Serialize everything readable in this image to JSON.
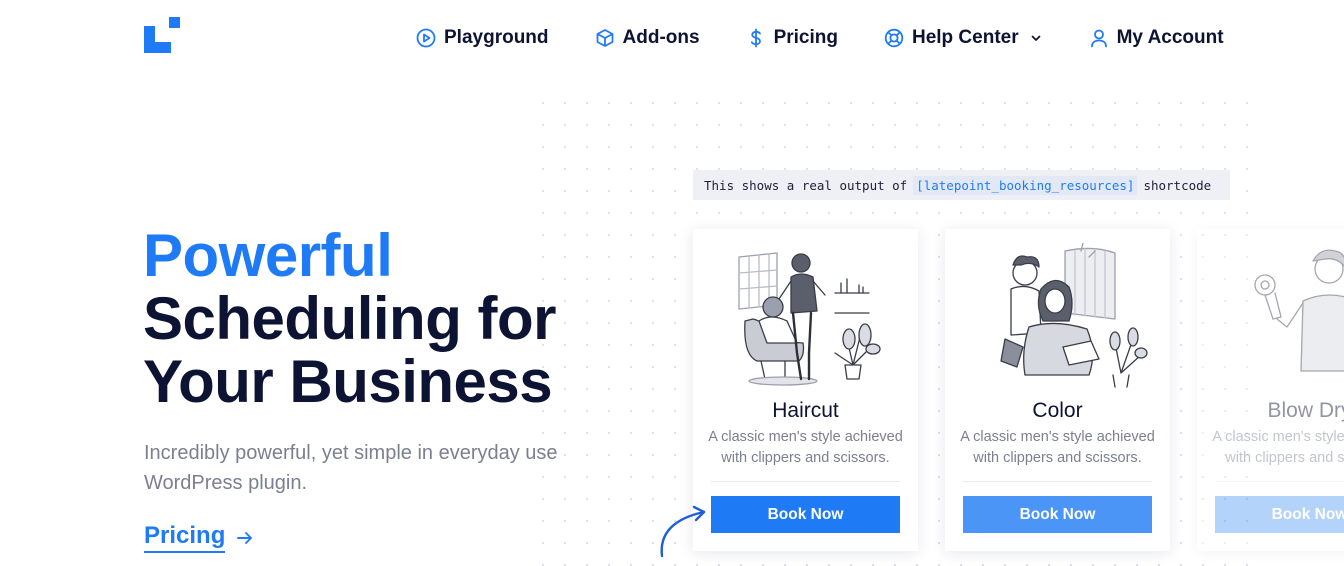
{
  "brand": {
    "logo_icon": "latepoint-logo-icon",
    "accent": "#1f7bf5",
    "text_dark": "#0d1333"
  },
  "nav": {
    "items": [
      {
        "label": "Playground",
        "icon": "play-circle-icon"
      },
      {
        "label": "Add-ons",
        "icon": "cube-icon"
      },
      {
        "label": "Pricing",
        "icon": "dollar-icon"
      },
      {
        "label": "Help Center",
        "icon": "lifebuoy-icon",
        "dropdown": true
      },
      {
        "label": "My Account",
        "icon": "user-icon"
      }
    ]
  },
  "hero": {
    "title_highlight": "Powerful",
    "title_line2": "Scheduling for",
    "title_line3": "Your Business",
    "subtitle": "Incredibly powerful, yet simple in everyday use WordPress plugin.",
    "pricing_link": "Pricing"
  },
  "demo": {
    "label_prefix": "This shows a real output of",
    "shortcode": "[latepoint_booking_resources]",
    "label_suffix": "shortcode",
    "cards": [
      {
        "title": "Haircut",
        "description": "A classic men's style achieved with clippers and scissors.",
        "button": "Book Now",
        "illustration": "barber-haircut-illustration"
      },
      {
        "title": "Color",
        "description": "A classic men's style achieved with clippers and scissors.",
        "button": "Book Now",
        "illustration": "hair-color-illustration"
      },
      {
        "title": "Blow Dry",
        "description": "A classic men's style achieved with clippers and scissors.",
        "button": "Book Now",
        "illustration": "blow-dry-illustration"
      }
    ]
  }
}
